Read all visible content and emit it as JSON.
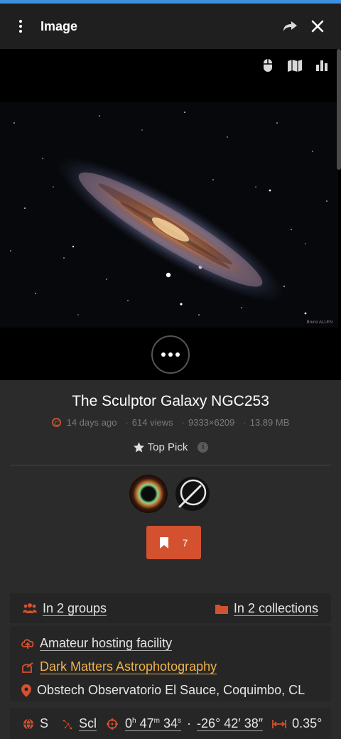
{
  "header": {
    "title": "Image",
    "icons": [
      "kebab-menu-icon",
      "share-icon",
      "close-icon"
    ]
  },
  "viewer": {
    "tools": [
      "mouse-icon",
      "map-icon",
      "chart-icon"
    ],
    "credit": "Bruno ALLEN"
  },
  "image": {
    "title": "The Sculptor Galaxy NGC253",
    "license_icon": "creative-commons-icon",
    "age": "14 days ago",
    "views": "614 views",
    "resolution": "9333×6209",
    "size": "13.89 MB"
  },
  "top_pick": {
    "label": "Top Pick",
    "info": "i"
  },
  "bookmark": {
    "count": "7"
  },
  "groups": {
    "label": "In 2 groups"
  },
  "collections": {
    "label": "In 2 collections"
  },
  "facility": {
    "type": "Amateur hosting facility",
    "name": "Dark Matters Astrophotography",
    "location": "Obstech Observatorio El Sauce, Coquimbo, CL"
  },
  "coordinates": {
    "hemisphere": "S",
    "constellation": "Scl",
    "ra_h": "0",
    "ra_m": "47",
    "ra_s": "34",
    "dot": "·",
    "dec_d": "-26",
    "dec_m": "42",
    "dec_s": "38",
    "field": "0.35°"
  },
  "colors": {
    "accent": "#d3512f",
    "link_orange": "#f0b24a",
    "header_bg": "#1f1f1f",
    "panel_bg": "#2b2b2b"
  }
}
